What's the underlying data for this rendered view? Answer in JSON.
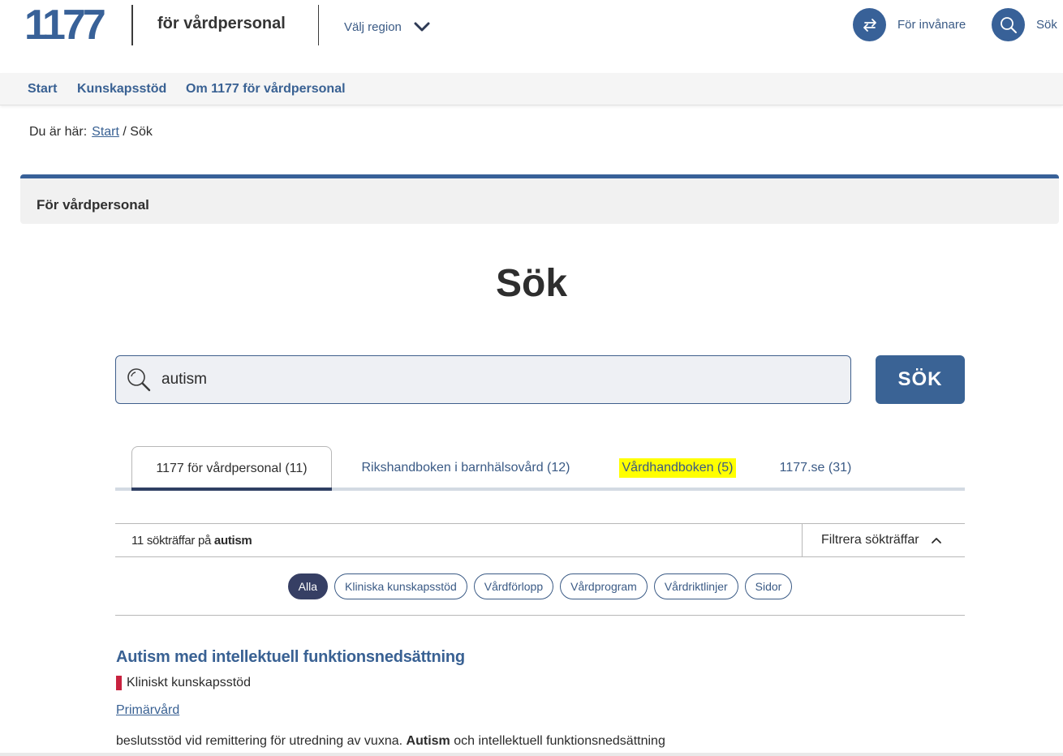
{
  "header": {
    "logo_text": "1177",
    "brand": "för vårdpersonal",
    "region_label": "Välj region",
    "residents_label": "För invånare",
    "search_label": "Sök"
  },
  "nav": {
    "items": [
      {
        "label": "Start"
      },
      {
        "label": "Kunskapsstöd"
      },
      {
        "label": "Om 1177 för vårdpersonal"
      }
    ]
  },
  "breadcrumb": {
    "prefix": "Du är här:",
    "start": "Start",
    "separator": "/",
    "current": "Sök"
  },
  "banner": {
    "label": "För vårdpersonal"
  },
  "page": {
    "title": "Sök"
  },
  "search": {
    "value": "autism",
    "button_label": "SÖK"
  },
  "tabs": [
    {
      "label": "1177 för vårdpersonal (11)",
      "active": true
    },
    {
      "label": "Rikshandboken i barnhälsovård (12)",
      "active": false
    },
    {
      "label": "Vårdhandboken (5)",
      "active": false,
      "highlighted": true
    },
    {
      "label": "1177.se (31)",
      "active": false
    }
  ],
  "results": {
    "count_text": "11 sökträffar på",
    "query": "autism",
    "filter_label": "Filtrera sökträffar"
  },
  "chips": [
    {
      "label": "Alla",
      "active": true
    },
    {
      "label": "Kliniska kunskapsstöd",
      "active": false
    },
    {
      "label": "Vårdförlopp",
      "active": false
    },
    {
      "label": "Vårdprogram",
      "active": false
    },
    {
      "label": "Vårdriktlinjer",
      "active": false
    },
    {
      "label": "Sidor",
      "active": false
    }
  ],
  "result_items": [
    {
      "title": "Autism med intellektuell funktionsnedsättning",
      "type": "Kliniskt kunskapsstöd",
      "link": "Primärvård",
      "snippet_before": "beslutsstöd vid remittering för utredning av vuxna.",
      "snippet_bold": "Autism",
      "snippet_after": "och intellektuell funktionsnedsättning"
    }
  ],
  "colors": {
    "primary": "#386198",
    "active_tab_underline": "#2f3f63",
    "highlight": "#ffff00",
    "type_marker": "#c8223f",
    "chip_active": "#363f64"
  }
}
